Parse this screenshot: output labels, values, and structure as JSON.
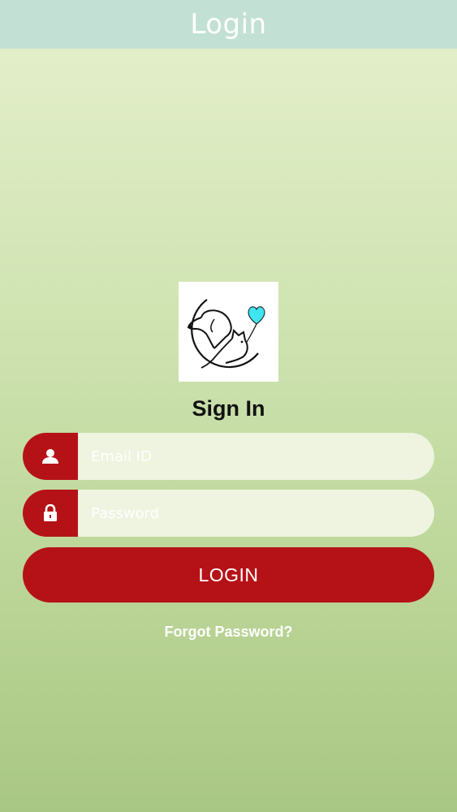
{
  "header": {
    "title": "Login"
  },
  "logo": {
    "icon": "dog-cat-heart-logo",
    "heart_color": "#3fe6f0"
  },
  "form": {
    "title": "Sign In",
    "email": {
      "placeholder": "Email ID",
      "value": "",
      "icon": "user-icon"
    },
    "password": {
      "placeholder": "Password",
      "value": "",
      "icon": "lock-icon"
    },
    "login_label": "LOGIN",
    "forgot_label": "Forgot Password?"
  },
  "colors": {
    "accent": "#b51217",
    "header_bg": "#c2e1d4",
    "field_bg": "#eef4df"
  }
}
